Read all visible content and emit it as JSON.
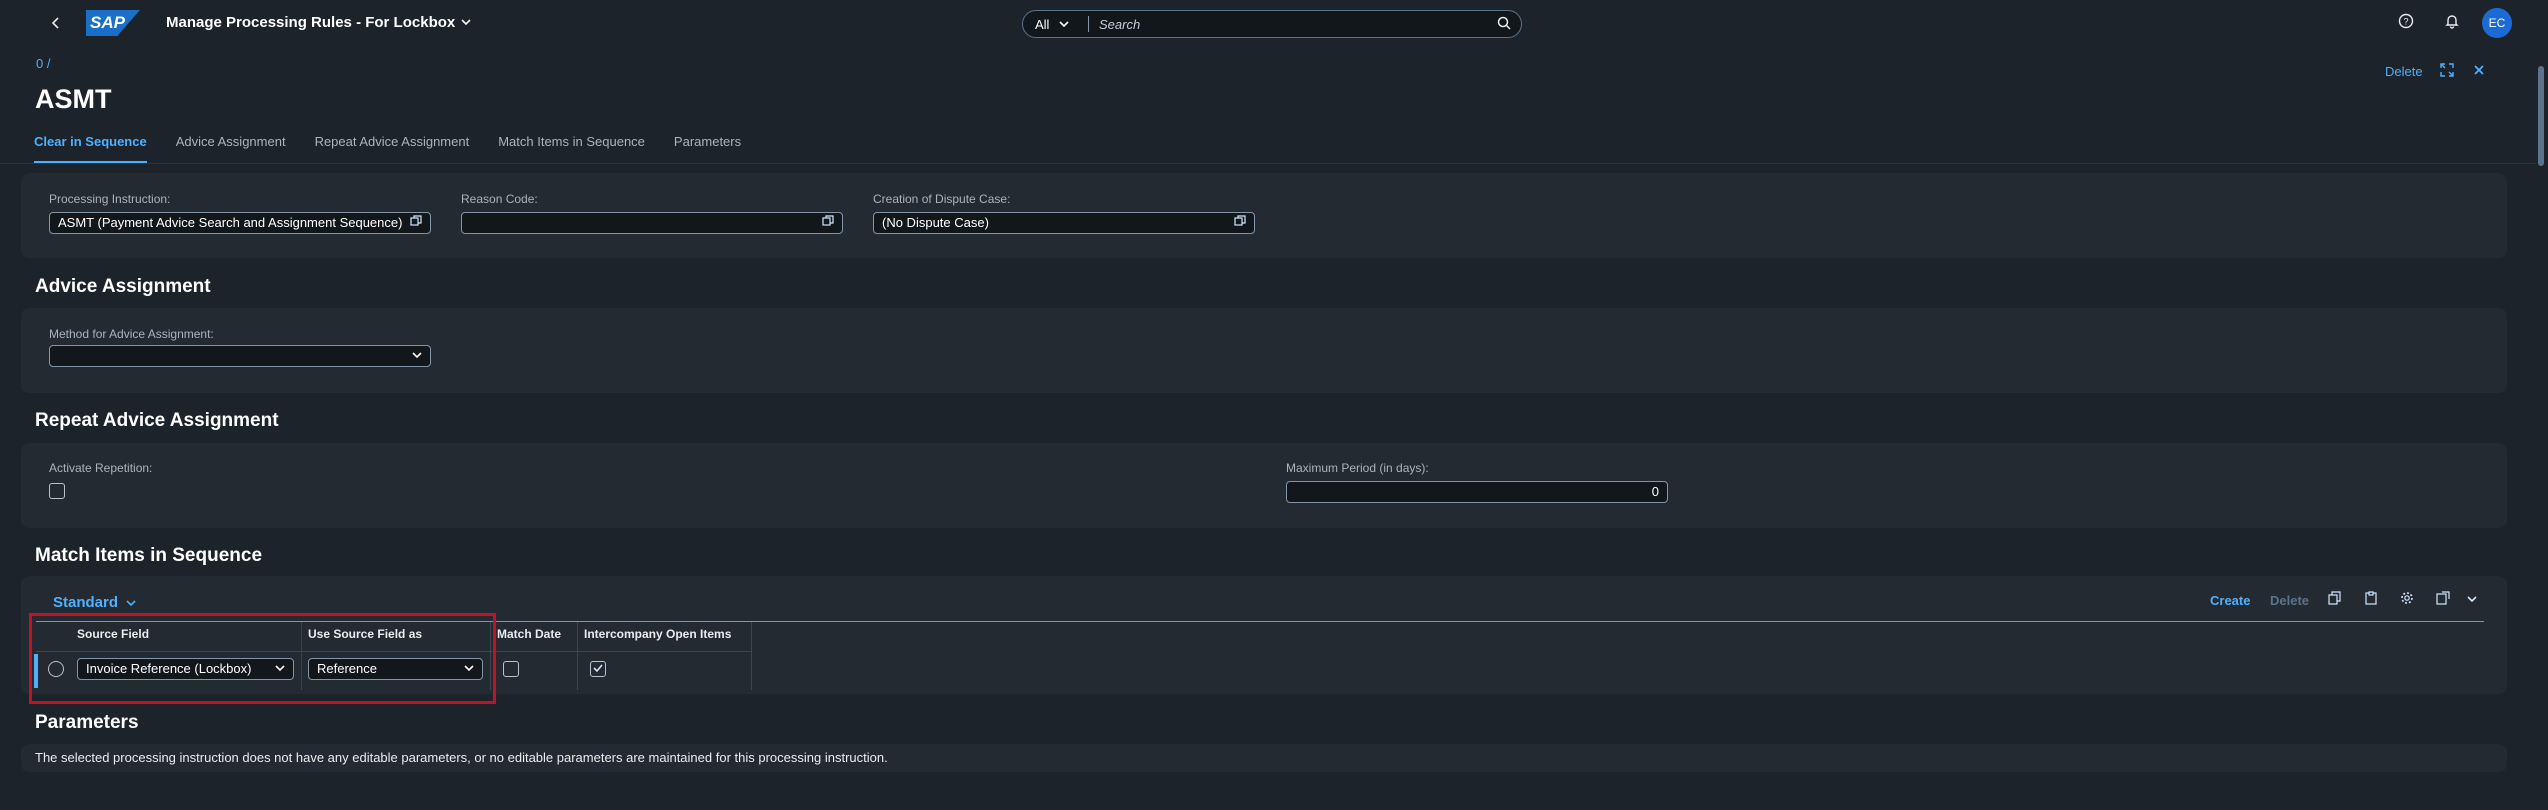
{
  "shell": {
    "back_icon": "chevron-left-icon",
    "logo_text": "SAP",
    "app_title": "Manage Processing Rules - For Lockbox",
    "search_scope": "All",
    "search_placeholder": "Search",
    "avatar_initials": "EC"
  },
  "header": {
    "breadcrumb": "0 /",
    "title": "ASMT",
    "delete_label": "Delete"
  },
  "tabs": [
    {
      "label": "Clear in Sequence",
      "active": true
    },
    {
      "label": "Advice Assignment"
    },
    {
      "label": "Repeat Advice Assignment"
    },
    {
      "label": "Match Items in Sequence"
    },
    {
      "label": "Parameters"
    }
  ],
  "clear_in_sequence": {
    "processing_instruction_label": "Processing Instruction:",
    "processing_instruction_value": "ASMT (Payment Advice Search and Assignment Sequence)",
    "reason_code_label": "Reason Code:",
    "reason_code_value": "",
    "dispute_case_label": "Creation of Dispute Case:",
    "dispute_case_value": "(No Dispute Case)"
  },
  "advice_assignment": {
    "title": "Advice Assignment",
    "method_label": "Method for Advice Assignment:",
    "method_value": ""
  },
  "repeat_advice_assignment": {
    "title": "Repeat Advice Assignment",
    "activate_label": "Activate Repetition:",
    "activate_checked": false,
    "max_period_label": "Maximum Period (in days):",
    "max_period_value": "0"
  },
  "match_items": {
    "title": "Match Items in Sequence",
    "variant": "Standard",
    "create_label": "Create",
    "delete_label": "Delete",
    "columns": [
      "Source Field",
      "Use Source Field as",
      "Match Date",
      "Intercompany Open Items"
    ],
    "rows": [
      {
        "source_field": "Invoice Reference (Lockbox)",
        "use_as": "Reference",
        "match_date": false,
        "intercompany": true
      }
    ]
  },
  "parameters": {
    "title": "Parameters",
    "message": "The selected processing instruction does not have any editable parameters, or no editable parameters are maintained for this processing instruction."
  }
}
